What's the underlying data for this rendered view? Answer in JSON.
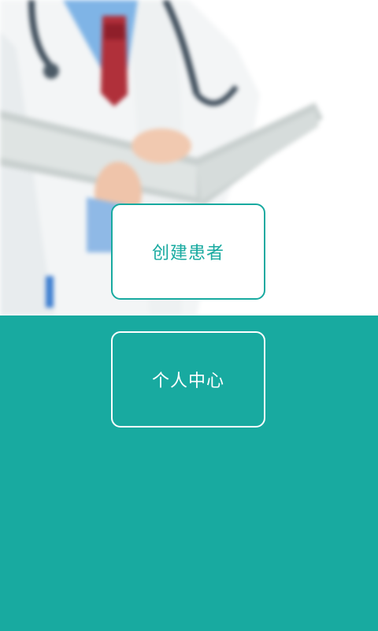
{
  "hero": {
    "image": "doctor-holding-open-book"
  },
  "buttons": {
    "create_patient_label": "创建患者",
    "personal_center_label": "个人中心"
  },
  "colors": {
    "accent": "#18AAA0",
    "button_bg_light": "#FFFFFF",
    "button_text_light": "#18AAA0",
    "button_text_dark": "#FFFFFF"
  }
}
